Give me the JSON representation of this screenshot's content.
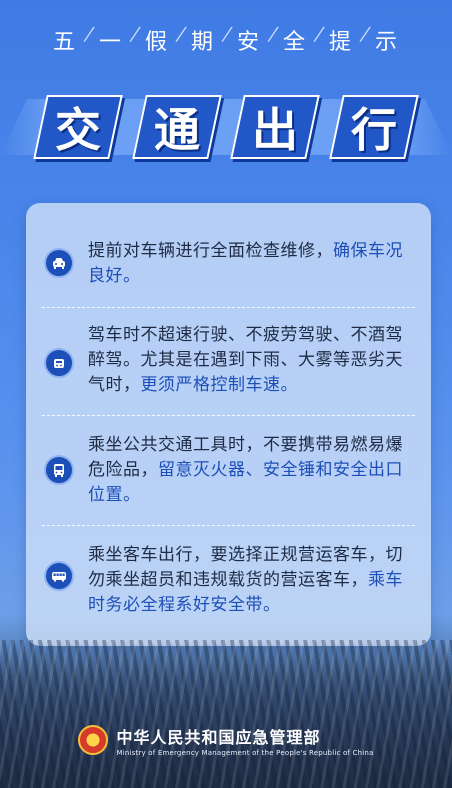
{
  "header": {
    "subtitle_chars": [
      "五",
      "一",
      "假",
      "期",
      "安",
      "全",
      "提",
      "示"
    ],
    "separator": "/",
    "title_chars": [
      "交",
      "通",
      "出",
      "行"
    ]
  },
  "tips": [
    {
      "icon": "car-front-icon",
      "normal": "提前对车辆进行全面检查维修，",
      "highlight": "确保车况良好。"
    },
    {
      "icon": "car-speed-icon",
      "normal": "驾车时不超速行驶、不疲劳驾驶、不酒驾醉驾。尤其是在遇到下雨、大雾等恶劣天气时，",
      "highlight": "更须严格控制车速。"
    },
    {
      "icon": "bus-icon",
      "normal": "乘坐公共交通工具时，不要携带易燃易爆危险品，",
      "highlight": "留意灭火器、安全锤和安全出口位置。"
    },
    {
      "icon": "coach-icon",
      "normal": "乘坐客车出行，要选择正规营运客车，切勿乘坐超员和违规载货的营运客车，",
      "highlight": "乘车时务必全程系好安全带。"
    }
  ],
  "footer": {
    "org_name": "中华人民共和国应急管理部",
    "org_name_en": "Ministry of Emergency Management of the People's Republic of China",
    "emblem": "national-emblem-icon"
  },
  "colors": {
    "background": "#4a86ea",
    "title_tile": "#2157c7",
    "highlight_text": "#1d4fb8",
    "body_text": "#1f2b44"
  }
}
